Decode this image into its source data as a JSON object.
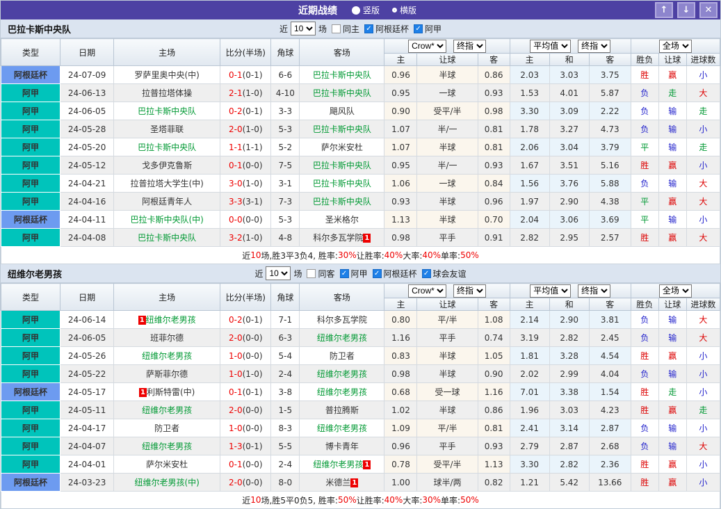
{
  "title_bar": {
    "title": "近期战绩",
    "vertical_label": "竖版",
    "horizontal_label": "横版",
    "up_icon": "↑",
    "down_icon": "↓",
    "close_icon": "✕"
  },
  "labels": {
    "near": "近",
    "games": "场"
  },
  "columns": {
    "type": "类型",
    "date": "日期",
    "home": "主场",
    "score": "比分(半场)",
    "corner": "角球",
    "away": "客场",
    "h": "主",
    "handicap": "让球",
    "a": "客",
    "avg_h": "主",
    "avg_d": "和",
    "avg_a": "客",
    "result": "胜负",
    "handicap_result": "让球",
    "goals": "进球数"
  },
  "colors": {
    "titlebar_bg": "#4d41a3",
    "button_bg": "#8d85cd",
    "team_highlight": "#009933",
    "badge_bg": "#ee0000",
    "checkbox_on": "#1e80e8"
  },
  "league_colors": {
    "阿甲": "#00c4bb",
    "阿根廷杯": "#6d9bf0"
  },
  "result_colors": {
    "胜": "#dd0000",
    "负": "#2222cc",
    "平": "#009933",
    "赢": "#dd0000",
    "输": "#2222cc",
    "走": "#009933",
    "大": "#dd0000",
    "小": "#2222cc"
  },
  "tables": [
    {
      "team": "巴拉卡斯中央队",
      "filter": {
        "games": "10",
        "same": {
          "label": "同主",
          "checked": false
        },
        "leagues": [
          {
            "label": "阿根廷杯",
            "checked": true
          },
          {
            "label": "阿甲",
            "checked": true
          }
        ]
      },
      "dropdowns": {
        "odds": "Crow*",
        "odds_period": "终指",
        "avg": "平均值",
        "avg_period": "终指",
        "scope": "全场"
      },
      "rows": [
        {
          "league": "阿根廷杯",
          "date": "24-07-09",
          "home": {
            "name": "罗萨里奥中央(中)",
            "green": false
          },
          "score": "0-1",
          "half": "(0-1)",
          "corner": "6-6",
          "away": {
            "name": "巴拉卡斯中央队",
            "green": true
          },
          "h": "0.96",
          "handicap": "半球",
          "a": "0.86",
          "avg_h": "2.03",
          "avg_d": "3.03",
          "avg_a": "3.75",
          "result": "胜",
          "handicap_result": "赢",
          "goals": "小"
        },
        {
          "league": "阿甲",
          "date": "24-06-13",
          "home": {
            "name": "拉普拉塔体操",
            "green": false
          },
          "score": "2-1",
          "half": "(1-0)",
          "corner": "4-10",
          "away": {
            "name": "巴拉卡斯中央队",
            "green": true
          },
          "h": "0.95",
          "handicap": "一球",
          "a": "0.93",
          "avg_h": "1.53",
          "avg_d": "4.01",
          "avg_a": "5.87",
          "result": "负",
          "handicap_result": "走",
          "goals": "大"
        },
        {
          "league": "阿甲",
          "date": "24-06-05",
          "home": {
            "name": "巴拉卡斯中央队",
            "green": true
          },
          "score": "0-2",
          "half": "(0-1)",
          "corner": "3-3",
          "away": {
            "name": "飓风队",
            "green": false
          },
          "h": "0.90",
          "handicap": "受平/半",
          "a": "0.98",
          "avg_h": "3.30",
          "avg_d": "3.09",
          "avg_a": "2.22",
          "result": "负",
          "handicap_result": "输",
          "goals": "走"
        },
        {
          "league": "阿甲",
          "date": "24-05-28",
          "home": {
            "name": "圣塔菲联",
            "green": false
          },
          "score": "2-0",
          "half": "(1-0)",
          "corner": "5-3",
          "away": {
            "name": "巴拉卡斯中央队",
            "green": true
          },
          "h": "1.07",
          "handicap": "半/一",
          "a": "0.81",
          "avg_h": "1.78",
          "avg_d": "3.27",
          "avg_a": "4.73",
          "result": "负",
          "handicap_result": "输",
          "goals": "小"
        },
        {
          "league": "阿甲",
          "date": "24-05-20",
          "home": {
            "name": "巴拉卡斯中央队",
            "green": true
          },
          "score": "1-1",
          "half": "(1-1)",
          "corner": "5-2",
          "away": {
            "name": "萨尔米安杜",
            "green": false
          },
          "h": "1.07",
          "handicap": "半球",
          "a": "0.81",
          "avg_h": "2.06",
          "avg_d": "3.04",
          "avg_a": "3.79",
          "result": "平",
          "handicap_result": "输",
          "goals": "走"
        },
        {
          "league": "阿甲",
          "date": "24-05-12",
          "home": {
            "name": "戈多伊克鲁斯",
            "green": false
          },
          "score": "0-1",
          "half": "(0-0)",
          "corner": "7-5",
          "away": {
            "name": "巴拉卡斯中央队",
            "green": true
          },
          "h": "0.95",
          "handicap": "半/一",
          "a": "0.93",
          "avg_h": "1.67",
          "avg_d": "3.51",
          "avg_a": "5.16",
          "result": "胜",
          "handicap_result": "赢",
          "goals": "小"
        },
        {
          "league": "阿甲",
          "date": "24-04-21",
          "home": {
            "name": "拉普拉塔大学生(中)",
            "green": false
          },
          "score": "3-0",
          "half": "(1-0)",
          "corner": "3-1",
          "away": {
            "name": "巴拉卡斯中央队",
            "green": true
          },
          "h": "1.06",
          "handicap": "一球",
          "a": "0.84",
          "avg_h": "1.56",
          "avg_d": "3.76",
          "avg_a": "5.88",
          "result": "负",
          "handicap_result": "输",
          "goals": "大"
        },
        {
          "league": "阿甲",
          "date": "24-04-16",
          "home": {
            "name": "阿根廷青年人",
            "green": false
          },
          "score": "3-3",
          "half": "(3-1)",
          "corner": "7-3",
          "away": {
            "name": "巴拉卡斯中央队",
            "green": true
          },
          "h": "0.93",
          "handicap": "半球",
          "a": "0.96",
          "avg_h": "1.97",
          "avg_d": "2.90",
          "avg_a": "4.38",
          "result": "平",
          "handicap_result": "赢",
          "goals": "大"
        },
        {
          "league": "阿根廷杯",
          "date": "24-04-11",
          "home": {
            "name": "巴拉卡斯中央队(中)",
            "green": true
          },
          "score": "0-0",
          "half": "(0-0)",
          "corner": "5-3",
          "away": {
            "name": "圣米格尔",
            "green": false
          },
          "h": "1.13",
          "handicap": "半球",
          "a": "0.70",
          "avg_h": "2.04",
          "avg_d": "3.06",
          "avg_a": "3.69",
          "result": "平",
          "handicap_result": "输",
          "goals": "小"
        },
        {
          "league": "阿甲",
          "date": "24-04-08",
          "home": {
            "name": "巴拉卡斯中央队",
            "green": true
          },
          "score": "3-2",
          "half": "(1-0)",
          "corner": "4-8",
          "away": {
            "name": "科尔多瓦学院",
            "green": false,
            "badge": "1",
            "badge_pos": "after"
          },
          "h": "0.98",
          "handicap": "平手",
          "a": "0.91",
          "avg_h": "2.82",
          "avg_d": "2.95",
          "avg_a": "2.57",
          "result": "胜",
          "handicap_result": "赢",
          "goals": "大"
        }
      ],
      "summary": [
        {
          "text": "近",
          "red": false
        },
        {
          "text": "10",
          "red": true
        },
        {
          "text": "场,胜3平3负4, 胜率:",
          "red": false
        },
        {
          "text": "30%",
          "red": true
        },
        {
          "text": " 让胜率:",
          "red": false
        },
        {
          "text": "40%",
          "red": true
        },
        {
          "text": " 大率:",
          "red": false
        },
        {
          "text": "40%",
          "red": true
        },
        {
          "text": " 单率:",
          "red": false
        },
        {
          "text": "50%",
          "red": true
        }
      ]
    },
    {
      "team": "纽维尔老男孩",
      "filter": {
        "games": "10",
        "same": {
          "label": "同客",
          "checked": false
        },
        "leagues": [
          {
            "label": "阿甲",
            "checked": true
          },
          {
            "label": "阿根廷杯",
            "checked": true
          },
          {
            "label": "球会友谊",
            "checked": true
          }
        ]
      },
      "dropdowns": {
        "odds": "Crow*",
        "odds_period": "终指",
        "avg": "平均值",
        "avg_period": "终指",
        "scope": "全场"
      },
      "rows": [
        {
          "league": "阿甲",
          "date": "24-06-14",
          "home": {
            "name": "纽维尔老男孩",
            "green": true,
            "badge": "1",
            "badge_pos": "before"
          },
          "score": "0-2",
          "half": "(0-1)",
          "corner": "7-1",
          "away": {
            "name": "科尔多瓦学院",
            "green": false
          },
          "h": "0.80",
          "handicap": "平/半",
          "a": "1.08",
          "avg_h": "2.14",
          "avg_d": "2.90",
          "avg_a": "3.81",
          "result": "负",
          "handicap_result": "输",
          "goals": "大"
        },
        {
          "league": "阿甲",
          "date": "24-06-05",
          "home": {
            "name": "班菲尔德",
            "green": false
          },
          "score": "2-0",
          "half": "(0-0)",
          "corner": "6-3",
          "away": {
            "name": "纽维尔老男孩",
            "green": true
          },
          "h": "1.16",
          "handicap": "平手",
          "a": "0.74",
          "avg_h": "3.19",
          "avg_d": "2.82",
          "avg_a": "2.45",
          "result": "负",
          "handicap_result": "输",
          "goals": "大"
        },
        {
          "league": "阿甲",
          "date": "24-05-26",
          "home": {
            "name": "纽维尔老男孩",
            "green": true
          },
          "score": "1-0",
          "half": "(0-0)",
          "corner": "5-4",
          "away": {
            "name": "防卫者",
            "green": false
          },
          "h": "0.83",
          "handicap": "半球",
          "a": "1.05",
          "avg_h": "1.81",
          "avg_d": "3.28",
          "avg_a": "4.54",
          "result": "胜",
          "handicap_result": "赢",
          "goals": "小"
        },
        {
          "league": "阿甲",
          "date": "24-05-22",
          "home": {
            "name": "萨斯菲尔德",
            "green": false
          },
          "score": "1-0",
          "half": "(1-0)",
          "corner": "2-4",
          "away": {
            "name": "纽维尔老男孩",
            "green": true
          },
          "h": "0.98",
          "handicap": "半球",
          "a": "0.90",
          "avg_h": "2.02",
          "avg_d": "2.99",
          "avg_a": "4.04",
          "result": "负",
          "handicap_result": "输",
          "goals": "小"
        },
        {
          "league": "阿根廷杯",
          "date": "24-05-17",
          "home": {
            "name": "利斯特雷(中)",
            "green": false,
            "badge": "1",
            "badge_pos": "before"
          },
          "score": "0-1",
          "half": "(0-1)",
          "corner": "3-8",
          "away": {
            "name": "纽维尔老男孩",
            "green": true
          },
          "h": "0.68",
          "handicap": "受一球",
          "a": "1.16",
          "avg_h": "7.01",
          "avg_d": "3.38",
          "avg_a": "1.54",
          "result": "胜",
          "handicap_result": "走",
          "goals": "小"
        },
        {
          "league": "阿甲",
          "date": "24-05-11",
          "home": {
            "name": "纽维尔老男孩",
            "green": true
          },
          "score": "2-0",
          "half": "(0-0)",
          "corner": "1-5",
          "away": {
            "name": "普拉腾斯",
            "green": false
          },
          "h": "1.02",
          "handicap": "半球",
          "a": "0.86",
          "avg_h": "1.96",
          "avg_d": "3.03",
          "avg_a": "4.23",
          "result": "胜",
          "handicap_result": "赢",
          "goals": "走"
        },
        {
          "league": "阿甲",
          "date": "24-04-17",
          "home": {
            "name": "防卫者",
            "green": false
          },
          "score": "1-0",
          "half": "(0-0)",
          "corner": "8-3",
          "away": {
            "name": "纽维尔老男孩",
            "green": true
          },
          "h": "1.09",
          "handicap": "平/半",
          "a": "0.81",
          "avg_h": "2.41",
          "avg_d": "3.14",
          "avg_a": "2.87",
          "result": "负",
          "handicap_result": "输",
          "goals": "小"
        },
        {
          "league": "阿甲",
          "date": "24-04-07",
          "home": {
            "name": "纽维尔老男孩",
            "green": true
          },
          "score": "1-3",
          "half": "(0-1)",
          "corner": "5-5",
          "away": {
            "name": "博卡青年",
            "green": false
          },
          "h": "0.96",
          "handicap": "平手",
          "a": "0.93",
          "avg_h": "2.79",
          "avg_d": "2.87",
          "avg_a": "2.68",
          "result": "负",
          "handicap_result": "输",
          "goals": "大"
        },
        {
          "league": "阿甲",
          "date": "24-04-01",
          "home": {
            "name": "萨尔米安杜",
            "green": false
          },
          "score": "0-1",
          "half": "(0-0)",
          "corner": "2-4",
          "away": {
            "name": "纽维尔老男孩",
            "green": true,
            "badge": "1",
            "badge_pos": "after"
          },
          "h": "0.78",
          "handicap": "受平/半",
          "a": "1.13",
          "avg_h": "3.30",
          "avg_d": "2.82",
          "avg_a": "2.36",
          "result": "胜",
          "handicap_result": "赢",
          "goals": "小"
        },
        {
          "league": "阿根廷杯",
          "date": "24-03-23",
          "home": {
            "name": "纽维尔老男孩(中)",
            "green": true
          },
          "score": "2-0",
          "half": "(0-0)",
          "corner": "8-0",
          "away": {
            "name": "米德兰",
            "green": false,
            "badge": "1",
            "badge_pos": "after"
          },
          "h": "1.00",
          "handicap": "球半/两",
          "a": "0.82",
          "avg_h": "1.21",
          "avg_d": "5.42",
          "avg_a": "13.66",
          "result": "胜",
          "handicap_result": "赢",
          "goals": "小"
        }
      ],
      "summary": [
        {
          "text": "近",
          "red": false
        },
        {
          "text": "10",
          "red": true
        },
        {
          "text": "场,胜5平0负5, 胜率:",
          "red": false
        },
        {
          "text": "50%",
          "red": true
        },
        {
          "text": " 让胜率:",
          "red": false
        },
        {
          "text": "40%",
          "red": true
        },
        {
          "text": " 大率:",
          "red": false
        },
        {
          "text": "30%",
          "red": true
        },
        {
          "text": " 单率:",
          "red": false
        },
        {
          "text": "50%",
          "red": true
        }
      ]
    }
  ]
}
